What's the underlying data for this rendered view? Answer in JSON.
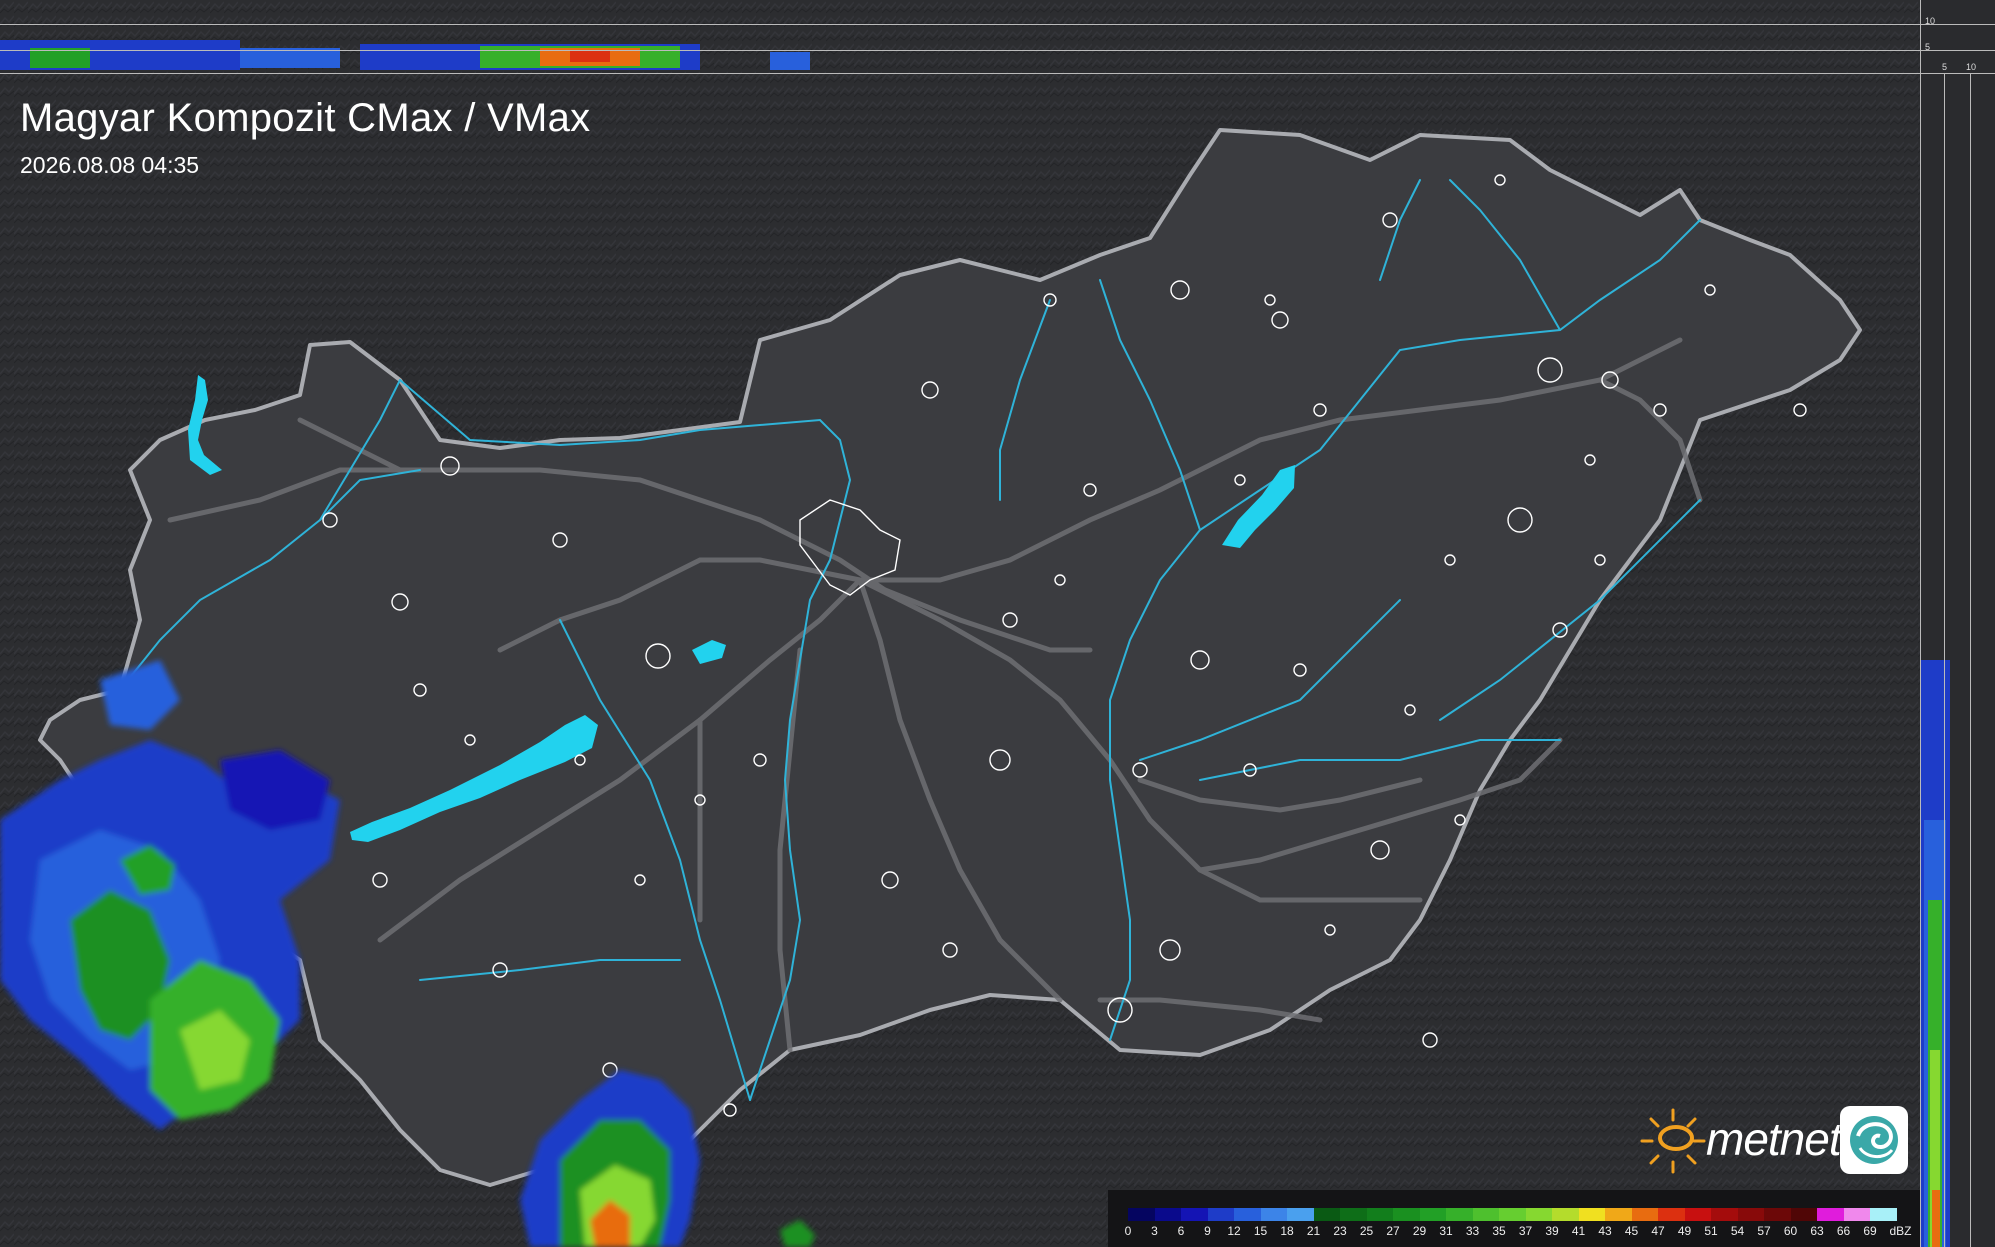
{
  "header": {
    "title": "Magyar Kompozit CMax / VMax",
    "timestamp": "2026.08.08 04:35"
  },
  "brand": {
    "name": "metnet",
    "sun_icon": "sun-icon",
    "swirl_icon": "swirl-icon"
  },
  "legend": {
    "unit": "dBZ",
    "labels": [
      "0",
      "3",
      "6",
      "9",
      "12",
      "15",
      "18",
      "21",
      "23",
      "25",
      "27",
      "29",
      "31",
      "33",
      "35",
      "37",
      "39",
      "41",
      "43",
      "45",
      "47",
      "49",
      "51",
      "54",
      "57",
      "60",
      "63",
      "66",
      "69"
    ],
    "colors": [
      "#050560",
      "#0a0a8c",
      "#1414b4",
      "#1e3cc8",
      "#2860dc",
      "#3c84e8",
      "#4aa0ee",
      "#0a5a14",
      "#0e6e18",
      "#127e1c",
      "#1a9020",
      "#22a026",
      "#36b02a",
      "#4ec02e",
      "#66ce30",
      "#86d830",
      "#b4dc2c",
      "#f0e020",
      "#f0a818",
      "#e86c10",
      "#dc3010",
      "#c81010",
      "#a40c0c",
      "#880a0a",
      "#6c0808",
      "#500606",
      "#e01cdc",
      "#f088ec",
      "#a8f0f8"
    ]
  },
  "profile_ticks": {
    "top": [
      "10",
      "5"
    ],
    "right": [
      "5",
      "10"
    ]
  },
  "colors": {
    "background": "#2a2b2e",
    "border": "#a9abb0",
    "river": "#2fb3d8",
    "lake": "#22d2ee",
    "road": "#6e6f73"
  }
}
